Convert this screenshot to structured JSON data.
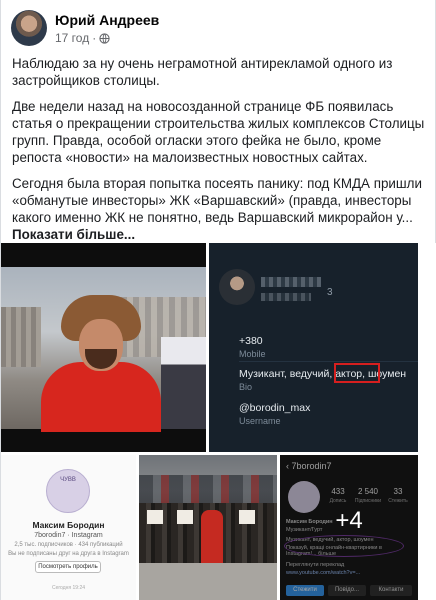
{
  "post": {
    "author": "Юрий Андреев",
    "time": "17 год",
    "separator": "·",
    "paragraphs": [
      "Наблюдаю за ну очень неграмотной антирекламой одного из застройщиков столицы.",
      "Две недели назад на новосозданной странице ФБ появилась статья о прекращении строительства жилых комплексов Столицы групп. Правда, особой огласки этого фейка не было, кроме репоста «новости» на малоизвестных новостных сайтах.",
      "Сегодня была вторая попытка посеять панику: под КМДА пришли «обманутые инвесторы» ЖК «Варшавский» (правда, инвесторы какого именно ЖК не понятно, ведь Варшавский микрорайон у..."
    ],
    "see_more": "Показати більше..."
  },
  "media": {
    "telegram": {
      "phone": "+380",
      "phone_suffix": "3",
      "phone_label": "Mobile",
      "bio": "Музикант, ведучий, актор, шоумен",
      "bio_label": "Bio",
      "username": "@borodin_max",
      "username_label": "Username"
    },
    "instagram_web": {
      "logo": "ЧУВВ",
      "name": "Максим Бородин",
      "handle": "7borodin7 · Instagram",
      "stats": "2,5 тыс. подписчиков · 434 публикаций",
      "hint": "Вы не подписаны друг на друга в Instagram",
      "button": "Посмотреть профиль",
      "footer": "Сегодня 19:24"
    },
    "instagram_mobile": {
      "username": "7borodin7",
      "posts": "433",
      "posts_label": "Допись",
      "followers": "2 540",
      "followers_label": "Підписники",
      "following": "33",
      "following_label": "Стежить",
      "bio_name": "Максим Бородин",
      "bio_role": "Музикант/Гурт",
      "bio_line1": "Музикант, ведучий, актор, шоумен",
      "bio_line2": "Показуй, кращі онлайн-квартирники в Instagram!... більше",
      "translate": "Переглянути переклад",
      "link": "www.youtube.com/watch?v=...",
      "btn_follow": "Стежити",
      "btn_msg": "Повідо...",
      "btn_contact": "Контакти",
      "more_count": "+4"
    }
  }
}
